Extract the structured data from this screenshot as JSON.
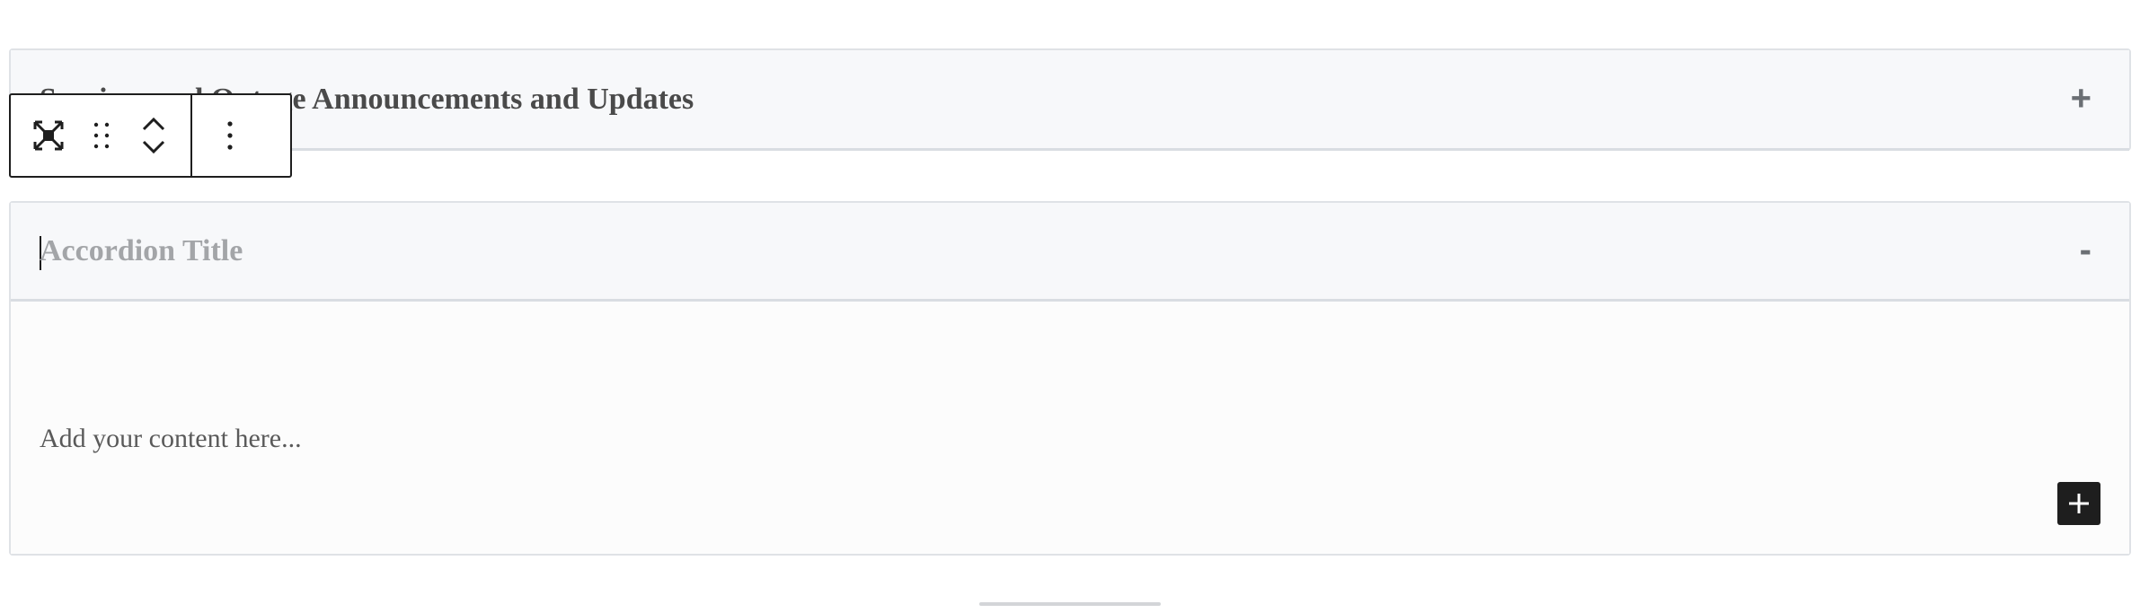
{
  "accordions": [
    {
      "title": "Services and Outage Announcements and Updates",
      "toggle": "+"
    },
    {
      "title": "Accordion Title",
      "toggle": "-",
      "content_placeholder": "Add your content here..."
    }
  ],
  "toolbar": {
    "icons": [
      "select-parent-icon",
      "drag-handle-icon",
      "chevron-up-icon",
      "chevron-down-icon",
      "more-options-icon"
    ]
  },
  "add_block": {
    "icon": "plus-icon"
  }
}
